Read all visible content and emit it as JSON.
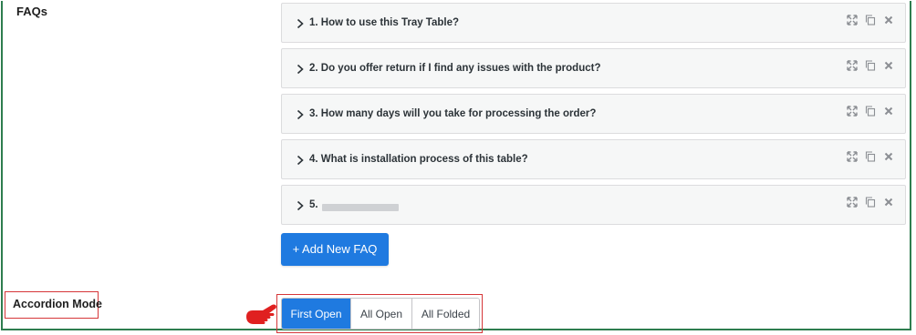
{
  "faqs_label": "FAQs",
  "faq_items": [
    {
      "title": "1. How to use this Tray Table?"
    },
    {
      "title": "2. Do you offer return if I find any issues with the product?"
    },
    {
      "title": "3. How many days will you take for processing the order?"
    },
    {
      "title": "4. What is installation process of this table?"
    },
    {
      "title": "5."
    }
  ],
  "faq_item_icons": [
    "expand-icon",
    "copy-icon",
    "close-icon"
  ],
  "add_button_label": "+ Add New FAQ",
  "accordion_mode": {
    "label": "Accordion Mode",
    "options": [
      "First Open",
      "All Open",
      "All Folded"
    ],
    "selected": "First Open"
  },
  "colors": {
    "primary": "#1f7ae0",
    "highlight_border": "#d63638",
    "pointer": "#e02020",
    "frame_border": "#2e7d4f"
  }
}
